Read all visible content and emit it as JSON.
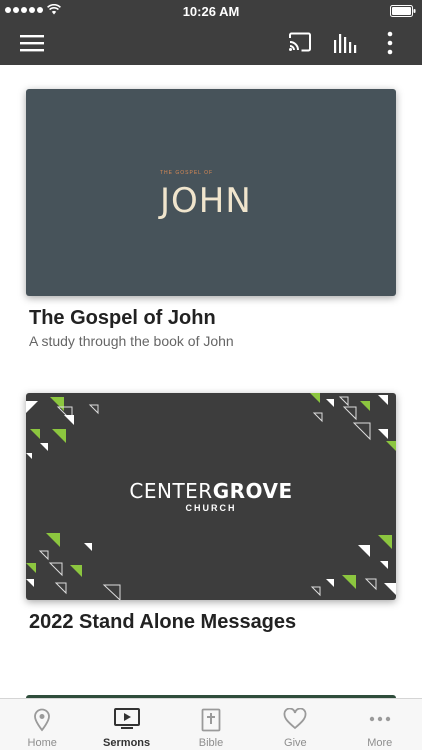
{
  "status_bar": {
    "time": "10:26 AM"
  },
  "series": [
    {
      "title": "The Gospel of John",
      "subtitle": "A study through the book of John",
      "art_small": "THE GOSPEL OF",
      "art_big": "JOHN"
    },
    {
      "title": "2022 Stand Alone Messages",
      "art_name_light": "CENTER",
      "art_name_bold": "GROVE",
      "art_sub": "CHURCH"
    }
  ],
  "tab_bar": {
    "tabs": [
      {
        "label": "Home",
        "icon": "location-pin-icon"
      },
      {
        "label": "Sermons",
        "icon": "play-screen-icon",
        "active": true
      },
      {
        "label": "Bible",
        "icon": "bible-icon"
      },
      {
        "label": "Give",
        "icon": "heart-icon"
      },
      {
        "label": "More",
        "icon": "more-dots-icon"
      }
    ]
  },
  "colors": {
    "app_bar": "#3e3e3e",
    "john_art_bg": "#47535a",
    "centergrove_art_bg": "#3d3d3d",
    "accent_green": "#8cc63f"
  }
}
